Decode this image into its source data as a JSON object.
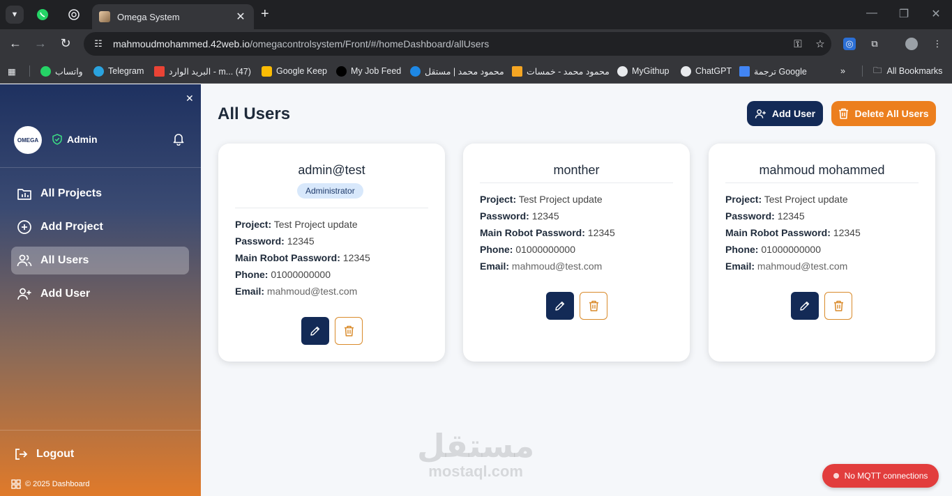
{
  "browser": {
    "tab_title": "Omega System",
    "url_domain": "mahmoudmohammed.42web.io",
    "url_path": "/omegacontrolsystem/Front/#/homeDashboard/allUsers",
    "bookmarks": [
      {
        "label": "واتساب",
        "color": "#25d366"
      },
      {
        "label": "Telegram",
        "color": "#2aa3df"
      },
      {
        "label": "البريد الوارد - m... (47)",
        "color": "#ea4335"
      },
      {
        "label": "Google Keep",
        "color": "#fbbc04"
      },
      {
        "label": "My Job Feed",
        "color": "#111111"
      },
      {
        "label": "محمود محمد | مستقل",
        "color": "#1e88e5"
      },
      {
        "label": "محمود محمد - خمسات",
        "color": "#f5a623"
      },
      {
        "label": "MyGithup",
        "color": "#e8eaed"
      },
      {
        "label": "ChatGPT",
        "color": "#e8eaed"
      },
      {
        "label": "ترجمة Google",
        "color": "#4285f4"
      }
    ],
    "all_bookmarks": "All Bookmarks"
  },
  "sidebar": {
    "avatar_text": "OMEGA",
    "role": "Admin",
    "nav": [
      {
        "label": "All Projects",
        "active": false
      },
      {
        "label": "Add Project",
        "active": false
      },
      {
        "label": "All Users",
        "active": true
      },
      {
        "label": "Add User",
        "active": false
      }
    ],
    "logout": "Logout",
    "copyright": "© 2025 Dashboard"
  },
  "main": {
    "title": "All Users",
    "add_user": "Add User",
    "delete_all": "Delete All Users",
    "labels": {
      "project": "Project:",
      "password": "Password:",
      "robot_password": "Main Robot Password:",
      "phone": "Phone:",
      "email": "Email:"
    },
    "users": [
      {
        "name": "admin@test",
        "badge": "Administrator",
        "project": "Test Project update",
        "password": "12345",
        "robot_password": "12345",
        "phone": "01000000000",
        "email": "mahmoud@test.com"
      },
      {
        "name": "monther",
        "badge": "",
        "project": "Test Project update",
        "password": "12345",
        "robot_password": "12345",
        "phone": "01000000000",
        "email": "mahmoud@test.com"
      },
      {
        "name": "mahmoud mohammed",
        "badge": "",
        "project": "Test Project update",
        "password": "12345",
        "robot_password": "12345",
        "phone": "01000000000",
        "email": "mahmoud@test.com"
      }
    ]
  },
  "mqtt_status": "No MQTT connections",
  "watermark": {
    "line1": "مستقل",
    "line2": "mostaql.com"
  }
}
